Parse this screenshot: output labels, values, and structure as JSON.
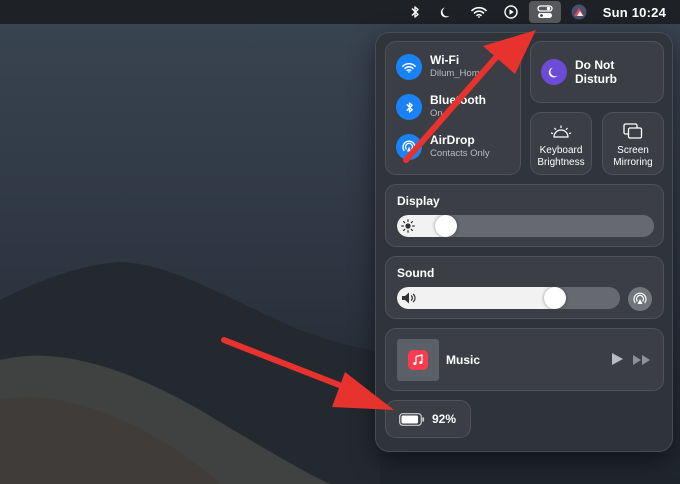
{
  "menubar": {
    "clock": "Sun 10:24",
    "icons": [
      "bluetooth-icon",
      "moon-icon",
      "wifi-icon",
      "play-circle-icon",
      "control-center-icon",
      "user-avatar-icon"
    ]
  },
  "control_center": {
    "wifi": {
      "label": "Wi-Fi",
      "sub": "Dilum_Home",
      "on": true
    },
    "bluetooth": {
      "label": "Bluetooth",
      "sub": "On",
      "on": true
    },
    "airdrop": {
      "label": "AirDrop",
      "sub": "Contacts Only",
      "on": true
    },
    "dnd": {
      "label": "Do Not Disturb"
    },
    "keyboard_brightness": {
      "label": "Keyboard Brightness"
    },
    "screen_mirroring": {
      "label": "Screen Mirroring"
    },
    "display": {
      "title": "Display",
      "level": 0.16
    },
    "sound": {
      "title": "Sound",
      "level": 0.73
    },
    "music": {
      "title": "Music"
    },
    "battery": {
      "percent": "92%",
      "level": 0.92
    }
  },
  "colors": {
    "accent_blue": "#1a82f7",
    "dnd_purple": "#6b4bd8",
    "music_red": "#fb3b4e",
    "annotation_red": "#e8322e"
  }
}
